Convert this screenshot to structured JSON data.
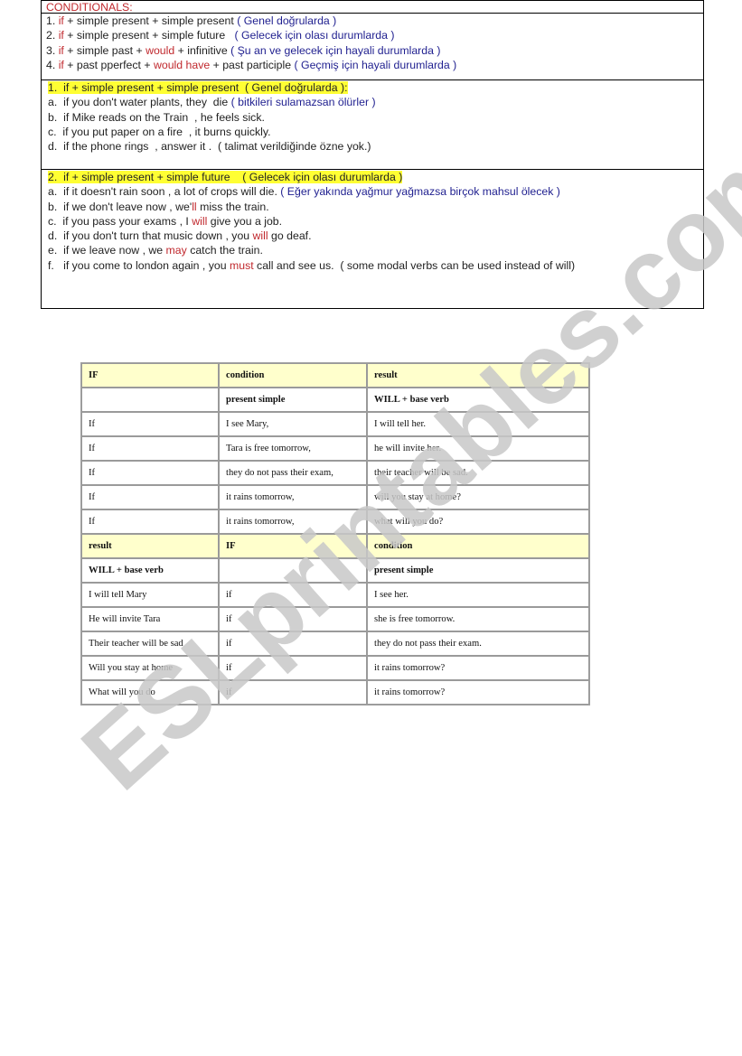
{
  "topbox": {
    "title": "CONDITIONALS:",
    "rules": [
      {
        "num": "1.",
        "if": "if",
        "p1": " + simple present + simple present ",
        "red2": "",
        "p2": "",
        "note": "( Genel doğrularda )"
      },
      {
        "num": "2.",
        "if": "if",
        "p1": " + simple present + simple future   ",
        "red2": "",
        "p2": "",
        "note": "( Gelecek için olası durumlarda )"
      },
      {
        "num": "3.",
        "if": "if",
        "p1": " + simple past + ",
        "red2": "would",
        "p2": " + infinitive ",
        "note": "( Şu an ve gelecek için hayali durumlarda )"
      },
      {
        "num": "4.",
        "if": "if",
        "p1": " + past pperfect + ",
        "red2": "would have",
        "p2": " + past participle ",
        "note": "( Geçmiş için hayali durumlarda )"
      }
    ],
    "section1": {
      "heading": "1.  if + simple present + simple present  ( Genel doğrularda ):",
      "items": [
        {
          "pre": "a.  if you don't water plants, they  die ",
          "red": "",
          "post": "",
          "note": "( bitkileri sulamazsan ölürler )"
        },
        {
          "pre": "b.  if Mike reads on the Train  , he feels sick.",
          "red": "",
          "post": "",
          "note": ""
        },
        {
          "pre": "c.  if you put paper on a fire  , it burns quickly.",
          "red": "",
          "post": "",
          "note": ""
        },
        {
          "pre": "d.  if the phone rings  , answer it .  ( talimat verildiğinde özne yok.)",
          "red": "",
          "post": "",
          "note": ""
        }
      ]
    },
    "section2": {
      "heading": "2.  if + simple present + simple future    ( Gelecek için olası durumlarda )",
      "items": [
        {
          "pre": "a.  if it doesn't rain soon , a lot of crops will die. ",
          "red": "",
          "post": "",
          "note": "( Eğer yakında yağmur yağmazsa birçok mahsul ölecek )"
        },
        {
          "pre": "b.  if we don't leave now , we'",
          "red": "ll",
          "post": " miss the train.",
          "note": ""
        },
        {
          "pre": "c.  if you pass your exams , I ",
          "red": "will",
          "post": " give you a job.",
          "note": ""
        },
        {
          "pre": "d.  if you don't turn that music down , you ",
          "red": "will",
          "post": " go deaf.",
          "note": ""
        },
        {
          "pre": "e.  if we leave now , we ",
          "red": "may",
          "post": " catch the train.",
          "note": ""
        },
        {
          "pre": "f.   if you come to london again , you ",
          "red": "must",
          "post": " call and see us.  ( some modal verbs can be used instead of will)",
          "note": ""
        }
      ]
    }
  },
  "table1": {
    "header": [
      "IF",
      "condition",
      "result"
    ],
    "subheader": [
      "",
      "present simple",
      "WILL + base verb"
    ],
    "rows": [
      [
        "If",
        "I see Mary,",
        "I will tell her."
      ],
      [
        "If",
        "Tara is free tomorrow,",
        "he will invite her."
      ],
      [
        "If",
        "they do not pass their exam,",
        "their teacher will be sad."
      ],
      [
        "If",
        "it rains tomorrow,",
        "will you stay at home?"
      ],
      [
        "If",
        "it rains tomorrow,",
        "what will you do?"
      ]
    ]
  },
  "table2": {
    "header": [
      "result",
      "IF",
      "condition"
    ],
    "subheader": [
      "WILL + base verb",
      "",
      "present simple"
    ],
    "rows": [
      [
        "I will tell Mary",
        "if",
        "I see her."
      ],
      [
        "He will invite Tara",
        "if",
        "she is free tomorrow."
      ],
      [
        "Their teacher will be sad",
        "if",
        "they do not pass their exam."
      ],
      [
        "Will you stay at home",
        "if",
        "it rains tomorrow?"
      ],
      [
        "What will you do",
        "if",
        "it rains tomorrow?"
      ]
    ]
  },
  "watermark": {
    "text": "ESLprintables.com",
    "color": "#c8c8c8"
  },
  "colors": {
    "red": "#c0282d",
    "blue": "#1f1f8f",
    "highlight": "#ffff33",
    "table_header": "#ffffcc"
  }
}
